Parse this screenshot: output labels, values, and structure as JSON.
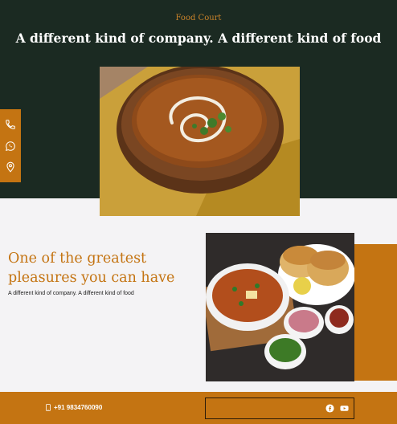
{
  "header": {
    "brand": "Food Court",
    "headline": "A different kind of company. A different kind of food"
  },
  "side_rail": {
    "icons": [
      "phone-icon",
      "whatsapp-icon",
      "location-pin-icon"
    ]
  },
  "feature": {
    "tagline": "One of the greatest pleasures you can have",
    "subline": "A different kind of company. A different kind of food"
  },
  "footer": {
    "phone": "+91 9834760090",
    "social_icons": [
      "facebook-icon",
      "youtube-icon"
    ]
  },
  "colors": {
    "dark_green": "#1b2a22",
    "accent_orange": "#c47412",
    "light_bg": "#f4f3f5"
  }
}
